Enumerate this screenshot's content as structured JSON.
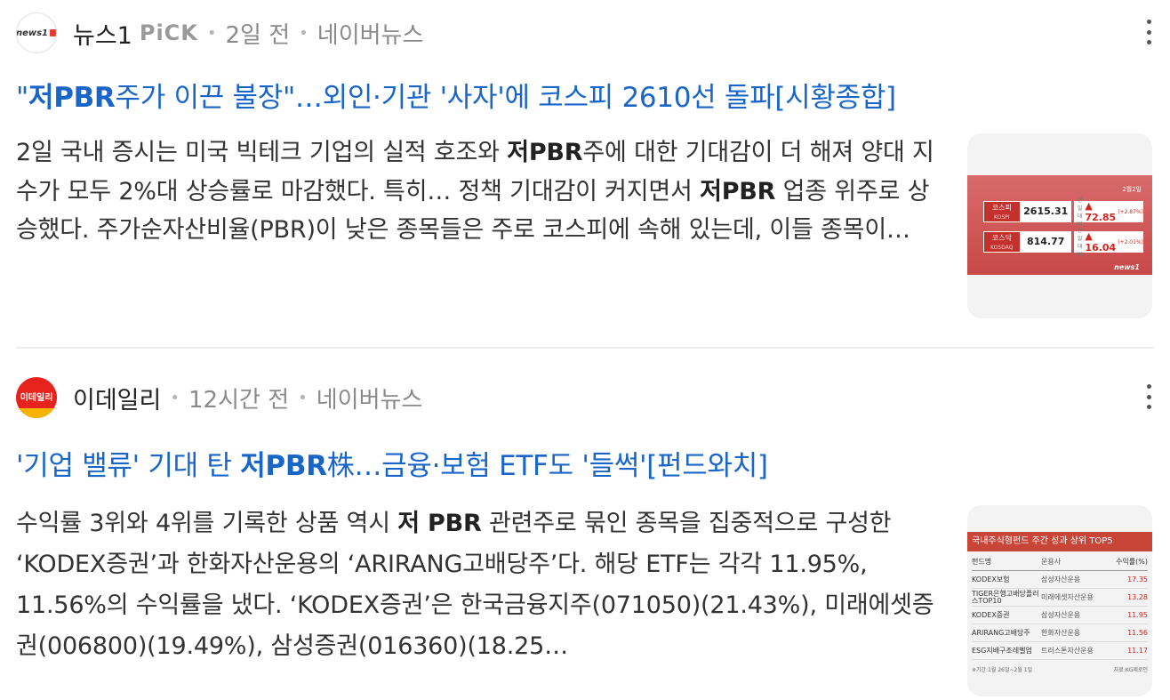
{
  "articles": [
    {
      "press": "뉴스1",
      "pick": "PiCK",
      "time": "2일 전",
      "portal": "네이버뉴스",
      "logo_text": "news1",
      "title_pre": "\"",
      "title_bold": "저PBR",
      "title_post": "주가 이끈 불장\"…외인·기관 '사자'에 코스피 2610선 돌파[시황종합]",
      "body": [
        {
          "t": "2일 국내 증시는 미국 빅테크 기업의 실적 호조와 ",
          "b": false
        },
        {
          "t": "저PBR",
          "b": true
        },
        {
          "t": "주에 대한 기대감이 더 해져 양대 지수가 모두 2%대 상승률로 마감했다. 특히… 정책 기대감이 커지면서 ",
          "b": false
        },
        {
          "t": "저PBR",
          "b": true
        },
        {
          "t": " 업종 위주로 상승했다. 주가순자산비율(PBR)이 낮은 종목들은 주로 코스피에 속해 있는데, 이들 종목이…",
          "b": false
        }
      ],
      "thumb": {
        "date": "2월2일",
        "rows": [
          {
            "name": "코스피",
            "sub": "KOSPI",
            "value": "2615.31",
            "change": "▲ 72.85",
            "pct": "(+2.87%)"
          },
          {
            "name": "코스닥",
            "sub": "KOSDAQ",
            "value": "814.77",
            "change": "▲ 16.04",
            "pct": "(+2.01%)"
          }
        ],
        "tiny_label": "전일대비",
        "brand": "news1"
      }
    },
    {
      "press": "이데일리",
      "time": "12시간 전",
      "portal": "네이버뉴스",
      "logo_text": "이데일리",
      "title_pre": "'기업 밸류' 기대 탄 ",
      "title_bold": "저PBR",
      "title_post": "株…금융·보험 ETF도 '들썩'[펀드와치]",
      "body": [
        {
          "t": "수익률 3위와 4위를 기록한 상품 역시 ",
          "b": false
        },
        {
          "t": "저 PBR",
          "b": true
        },
        {
          "t": " 관련주로 묶인 종목을 집중적으로 구성한 ‘KODEX증권’과 한화자산운용의 ‘ARIRANG고배당주’다. 해당 ETF는 각각 11.95%, 11.56%의 수익률을 냈다. ‘KODEX증권’은 한국금융지주(071050)(21.43%), 미래에셋증권(006800)(19.49%), 삼성증권(016360)(18.25…",
          "b": false
        }
      ],
      "thumb": {
        "header": "국내주식형펀드 주간 성과 상위 TOP5",
        "columns": [
          "펀드명",
          "운용사",
          "수익률(%)"
        ],
        "rows": [
          [
            "KODEX보험",
            "삼성자산운용",
            "17.35"
          ],
          [
            "TIGER은행고배당플러스TOP10",
            "미래에셋자산운용",
            "13.28"
          ],
          [
            "KODEX증권",
            "삼성자산운용",
            "11.95"
          ],
          [
            "ARIRANG고배당주",
            "한화자산운용",
            "11.56"
          ],
          [
            "ESG지배구조레벨업",
            "트러스톤자산운용",
            "11.17"
          ]
        ],
        "foot_left": "※기간:1월 26일~2월 1일",
        "foot_right": "자료:KG제로인"
      }
    }
  ]
}
